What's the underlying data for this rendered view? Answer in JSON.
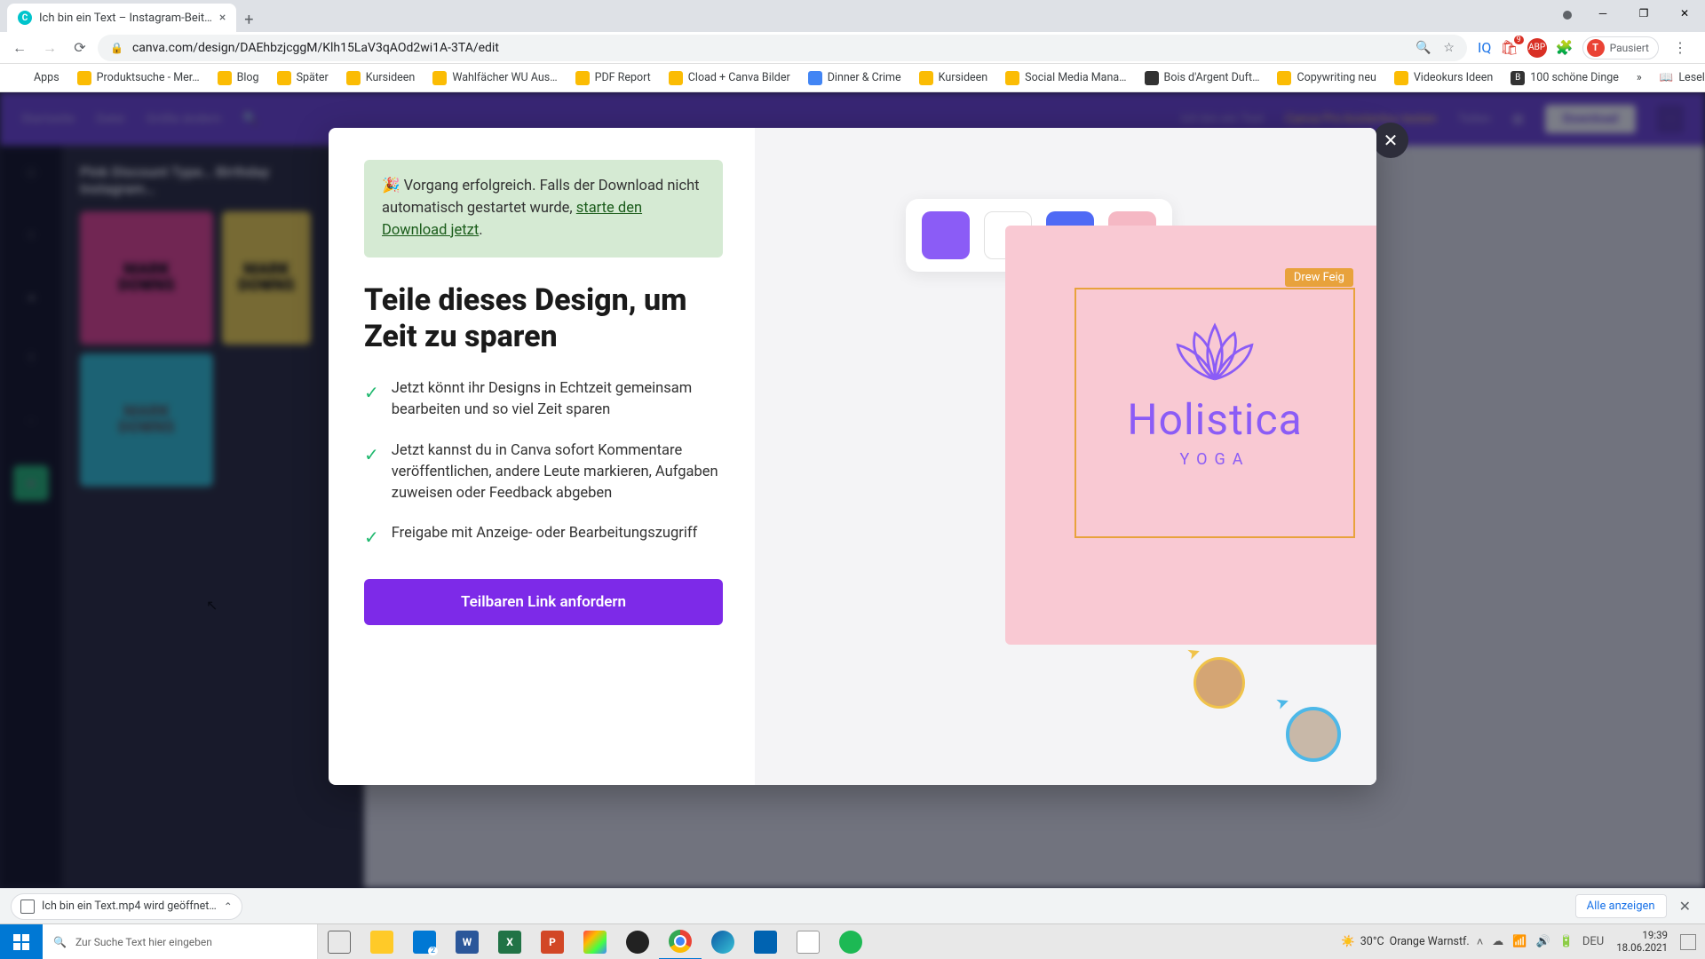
{
  "browser": {
    "tab_title": "Ich bin ein Text – Instagram-Beit…",
    "url": "canva.com/design/DAEhbzjcggM/Klh15LaV3qAOd2wi1A-3TA/edit",
    "profile_status": "Pausiert",
    "profile_initial": "T"
  },
  "bookmarks": {
    "apps": "Apps",
    "items": [
      "Produktsuche - Mer…",
      "Blog",
      "Später",
      "Kursideen",
      "Wahlfächer WU Aus…",
      "PDF Report",
      "Cload + Canva Bilder",
      "Dinner & Crime",
      "Kursideen",
      "Social Media Mana…",
      "Bois d'Argent Duft…",
      "Copywriting neu",
      "Videokurs Ideen",
      "100 schöne Dinge"
    ],
    "reading_list": "Leseliste"
  },
  "canva": {
    "header": [
      "Startseite",
      "Datei",
      "Größe ändern"
    ],
    "doc_title": "Ich bin ein Text",
    "pro": "Canva Pro kostenlos testen",
    "share": "Teilen",
    "download": "Download",
    "panel_title": "Pink Discount Type… Birthday Instagram…",
    "thumb_text": "MARK\nDOWNS"
  },
  "modal": {
    "success_prefix": "🎉 Vorgang erfolgreich. Falls der Download nicht automatisch gestartet wurde, ",
    "success_link": "starte den Download jetzt",
    "success_suffix": ".",
    "title": "Teile dieses Design, um Zeit zu sparen",
    "benefits": [
      "Jetzt könnt ihr Designs in Echtzeit gemeinsam bearbeiten und so viel Zeit sparen",
      "Jetzt kannst du in Canva sofort Kommentare veröffentlichen, andere Leute markieren, Aufgaben zuweisen oder Feedback abgeben",
      "Freigabe mit Anzeige- oder Bearbeitungszugriff"
    ],
    "cta": "Teilbaren Link anfordern",
    "preview": {
      "badge": "Drew Feig",
      "brand": "Holistica",
      "brand_sub": "YOGA",
      "palette": [
        "#8b5cf6",
        "#ffffff",
        "#4f6af5",
        "#f5b8c4"
      ]
    }
  },
  "downloads": {
    "item": "Ich bin ein Text.mp4 wird geöffnet…",
    "show_all": "Alle anzeigen"
  },
  "taskbar": {
    "search_placeholder": "Zur Suche Text hier eingeben",
    "weather_temp": "30°C",
    "weather_desc": "Orange Warnstf.",
    "lang": "DEU",
    "time": "19:39",
    "date": "18.06.2021"
  }
}
